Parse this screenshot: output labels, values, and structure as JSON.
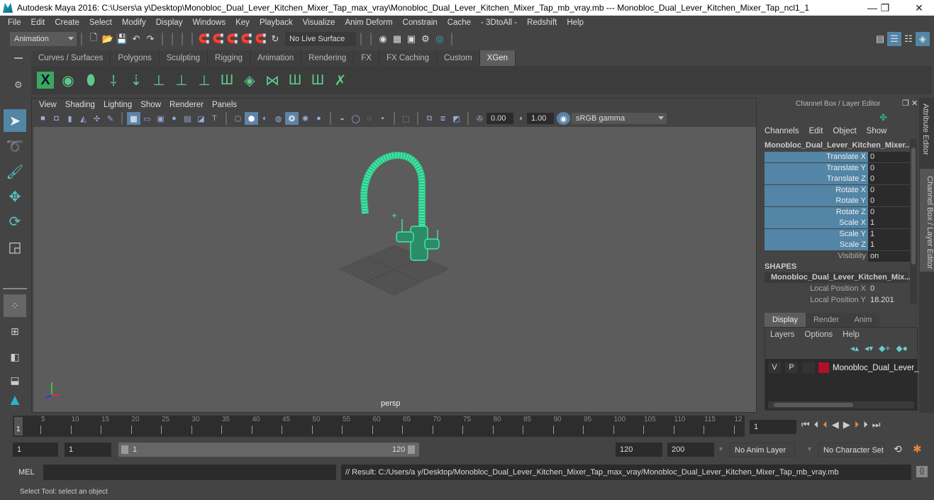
{
  "titlebar": {
    "title": "Autodesk Maya 2016: C:\\Users\\a y\\Desktop\\Monobloc_Dual_Lever_Kitchen_Mixer_Tap_max_vray\\Monobloc_Dual_Lever_Kitchen_Mixer_Tap_mb_vray.mb  ---  Monobloc_Dual_Lever_Kitchen_Mixer_Tap_ncl1_1",
    "minimize": "—",
    "maximize": "❐",
    "close": "✕"
  },
  "menubar": [
    "File",
    "Edit",
    "Create",
    "Select",
    "Modify",
    "Display",
    "Windows",
    "Key",
    "Playback",
    "Visualize",
    "Anim Deform",
    "Constrain",
    "Cache",
    "- 3DtoAll -",
    "Redshift",
    "Help"
  ],
  "statusline": {
    "menuset": "Animation",
    "live_surface": "No Live Surface"
  },
  "shelf": {
    "tabs": [
      "Curves / Surfaces",
      "Polygons",
      "Sculpting",
      "Rigging",
      "Animation",
      "Rendering",
      "FX",
      "FX Caching",
      "Custom",
      "XGen"
    ],
    "active_tab": "XGen",
    "icons": [
      "xgen-editor-icon",
      "xgen-preview-icon",
      "xgen-clear-preview-icon",
      "add-guide-icon",
      "move-guide-icon",
      "add-guide-base-icon",
      "sculpt-guide-icon",
      "lock-guide-icon",
      "guides-icon",
      "xgen-patches-icon",
      "rebuild-guides-icon",
      "select-guides-icon",
      "guides-outline-icon",
      "delete-guides-icon"
    ]
  },
  "viewport": {
    "menu": [
      "View",
      "Shading",
      "Lighting",
      "Show",
      "Renderer",
      "Panels"
    ],
    "exposure": "0.00",
    "gamma": "1.00",
    "colorspace": "sRGB gamma",
    "camera_label": "persp",
    "axis": {
      "x": "x",
      "y": "y",
      "z": "z"
    }
  },
  "channelbox": {
    "title": "Channel Box / Layer Editor",
    "menu": [
      "Channels",
      "Edit",
      "Object",
      "Show"
    ],
    "object_name": "Monobloc_Dual_Lever_Kitchen_Mixer...",
    "channels": [
      {
        "label": "Translate X",
        "value": "0"
      },
      {
        "label": "Translate Y",
        "value": "0"
      },
      {
        "label": "Translate Z",
        "value": "0"
      },
      {
        "label": "Rotate X",
        "value": "0"
      },
      {
        "label": "Rotate Y",
        "value": "0"
      },
      {
        "label": "Rotate Z",
        "value": "0"
      },
      {
        "label": "Scale X",
        "value": "1"
      },
      {
        "label": "Scale Y",
        "value": "1"
      },
      {
        "label": "Scale Z",
        "value": "1"
      },
      {
        "label": "Visibility",
        "value": "on"
      }
    ],
    "shapes_header": "SHAPES",
    "shape_name": "Monobloc_Dual_Lever_Kitchen_Mix...",
    "shape_channels": [
      {
        "label": "Local Position X",
        "value": "0"
      },
      {
        "label": "Local Position Y",
        "value": "18.201"
      }
    ]
  },
  "layereditor": {
    "tabs": [
      "Display",
      "Render",
      "Anim"
    ],
    "active_tab": "Display",
    "menu": [
      "Layers",
      "Options",
      "Help"
    ],
    "layers": [
      {
        "v": "V",
        "p": "P",
        "color": "#b0102a",
        "name": "Monobloc_Dual_Lever_K"
      }
    ]
  },
  "sidetabs": [
    "Attribute Editor",
    "Channel Box / Layer Editor"
  ],
  "timeline": {
    "ticks": [
      "5",
      "10",
      "15",
      "20",
      "25",
      "30",
      "35",
      "40",
      "45",
      "50",
      "55",
      "60",
      "65",
      "70",
      "75",
      "80",
      "85",
      "90",
      "95",
      "100",
      "105",
      "110",
      "115",
      "12"
    ],
    "current_marker": "1",
    "current_frame": "1"
  },
  "range": {
    "start": "1",
    "playback_start": "1",
    "slider_start": "1",
    "slider_end": "120",
    "playback_end": "120",
    "end": "200",
    "anim_layer": "No Anim Layer",
    "character_set": "No Character Set"
  },
  "cmdline": {
    "lang": "MEL",
    "input": "",
    "result": "// Result: C:/Users/a y/Desktop/Monobloc_Dual_Lever_Kitchen_Mixer_Tap_max_vray/Monobloc_Dual_Lever_Kitchen_Mixer_Tap_mb_vray.mb"
  },
  "helpline": "Select Tool: select an object",
  "colors": {
    "accent": "#5285a6",
    "wireframe": "#44e8a4",
    "layer": "#b0102a"
  }
}
